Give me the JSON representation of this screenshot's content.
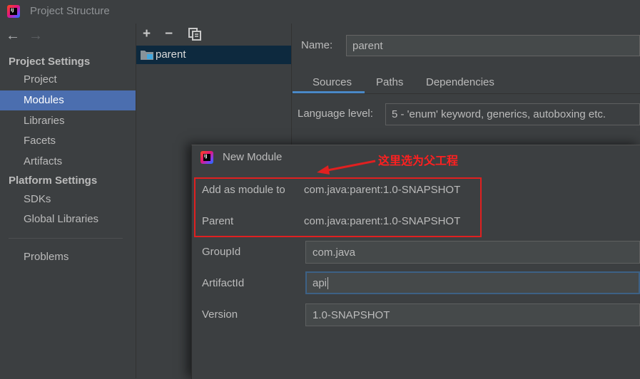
{
  "window": {
    "title": "Project Structure",
    "app_icon": "intellij-idea-icon",
    "app_icon_text": "IJ"
  },
  "nav": {
    "back": "←",
    "forward": "→"
  },
  "sidebar": {
    "project_settings_header": "Project Settings",
    "project_settings_items": [
      {
        "label": "Project",
        "selected": false
      },
      {
        "label": "Modules",
        "selected": true
      },
      {
        "label": "Libraries",
        "selected": false
      },
      {
        "label": "Facets",
        "selected": false
      },
      {
        "label": "Artifacts",
        "selected": false
      }
    ],
    "platform_settings_header": "Platform Settings",
    "platform_settings_items": [
      {
        "label": "SDKs"
      },
      {
        "label": "Global Libraries"
      }
    ],
    "problems_label": "Problems"
  },
  "module_toolbar": {
    "add": "+",
    "remove": "−",
    "copy": "copy-icon"
  },
  "module_tree": {
    "items": [
      {
        "label": "parent",
        "icon": "module-folder-icon",
        "selected": true
      }
    ]
  },
  "module_details": {
    "name_label": "Name:",
    "name_value": "parent",
    "tabs": [
      {
        "label": "Sources",
        "active": true
      },
      {
        "label": "Paths",
        "active": false
      },
      {
        "label": "Dependencies",
        "active": false
      }
    ],
    "language_level_label": "Language level:",
    "language_level_value": "5 - 'enum' keyword, generics, autoboxing etc."
  },
  "new_module_dialog": {
    "title": "New Module",
    "add_as_module_to_label": "Add as module to",
    "add_as_module_to_value": "com.java:parent:1.0-SNAPSHOT",
    "parent_label": "Parent",
    "parent_value": "com.java:parent:1.0-SNAPSHOT",
    "group_id_label": "GroupId",
    "group_id_value": "com.java",
    "artifact_id_label": "ArtifactId",
    "artifact_id_value": "api",
    "version_label": "Version",
    "version_value": "1.0-SNAPSHOT"
  },
  "annotation": {
    "text": "这里选为父工程",
    "color": "#ff2020"
  },
  "colors": {
    "background": "#3c3f41",
    "selection": "#4b6eaf",
    "tree_selection": "#0d293e",
    "tab_underline": "#4a88c7",
    "highlight_box": "#e02020"
  }
}
